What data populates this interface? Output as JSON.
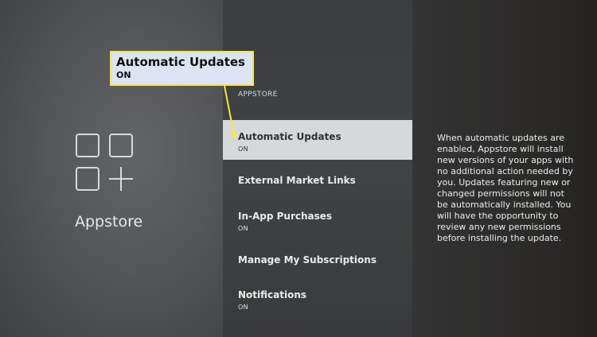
{
  "callout": {
    "title": "Automatic Updates",
    "value": "ON",
    "color": "#f3e84a"
  },
  "app": {
    "name": "Appstore",
    "icon": "appstore-grid-plus-icon"
  },
  "section_label": "APPSTORE",
  "menu": [
    {
      "label": "Automatic Updates",
      "value": "ON",
      "selected": true
    },
    {
      "label": "External Market Links",
      "value": ""
    },
    {
      "label": "In-App Purchases",
      "value": "ON"
    },
    {
      "label": "Manage My Subscriptions",
      "value": ""
    },
    {
      "label": "Notifications",
      "value": "ON"
    }
  ],
  "description": "When automatic updates are enabled, Appstore will install new versions of your apps with no additional action needed by you. Updates featuring new or changed permissions will not be automatically installed. You will have the opportunity to review any new permissions before installing the update."
}
